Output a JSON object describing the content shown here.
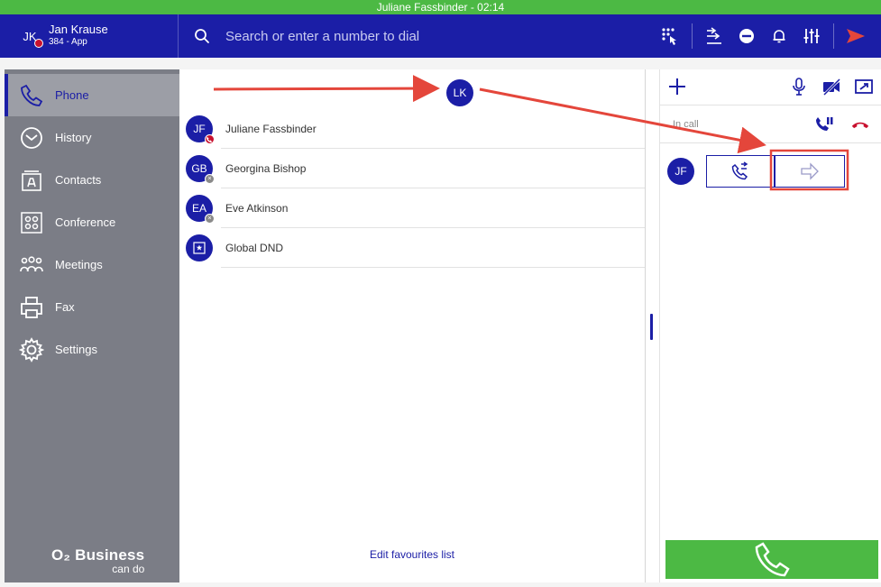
{
  "call_status": "Juliane Fassbinder - 02:14",
  "user": {
    "initials": "JK",
    "name": "Jan Krause",
    "extension": "384 - App"
  },
  "search": {
    "placeholder": "Search or enter a number to dial"
  },
  "header_icons": [
    "dialpad-icon",
    "call-forward-icon",
    "dnd-icon",
    "bell-icon",
    "sliders-icon",
    "send-icon"
  ],
  "nav": [
    {
      "label": "Phone",
      "icon": "phone-icon",
      "active": true
    },
    {
      "label": "History",
      "icon": "clock-icon",
      "active": false
    },
    {
      "label": "Contacts",
      "icon": "contacts-icon",
      "active": false
    },
    {
      "label": "Conference",
      "icon": "conference-icon",
      "active": false
    },
    {
      "label": "Meetings",
      "icon": "people-icon",
      "active": false
    },
    {
      "label": "Fax",
      "icon": "printer-icon",
      "active": false
    },
    {
      "label": "Settings",
      "icon": "gear-icon",
      "active": false
    }
  ],
  "brand": {
    "name": "O₂ Business",
    "tagline": "can do"
  },
  "drag_avatar": {
    "initials": "LK"
  },
  "favourites": [
    {
      "initials": "JF",
      "name": "Juliane Fassbinder",
      "status": "in-call",
      "status_color": "#c8102e"
    },
    {
      "initials": "GB",
      "name": "Georgina Bishop",
      "status": "offline",
      "status_color": "#8a8a8a"
    },
    {
      "initials": "EA",
      "name": "Eve Atkinson",
      "status": "offline",
      "status_color": "#8a8a8a"
    },
    {
      "initials": "",
      "name": "Global DND",
      "status": "none",
      "status_color": ""
    }
  ],
  "edit_favourites": "Edit favourites list",
  "call": {
    "state_label": "In call",
    "participant_initials": "JF"
  },
  "colors": {
    "brand_blue": "#1b1ea6",
    "call_green": "#4cb944",
    "sidebar_gray": "#7b7d86",
    "hangup_red": "#c8102e",
    "annotation_red": "#e4463b"
  }
}
